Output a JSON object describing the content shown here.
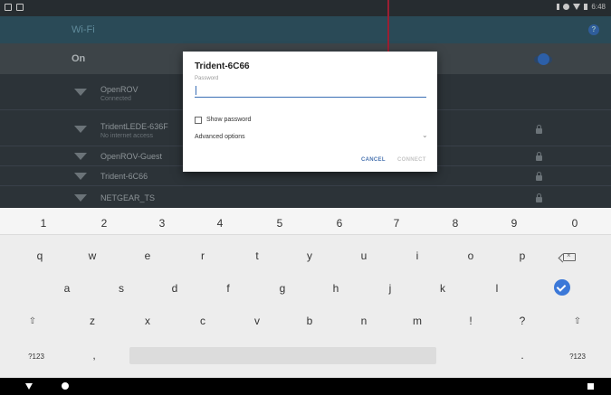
{
  "status_bar": {
    "time": "6:48"
  },
  "settings": {
    "title": "Wi-Fi",
    "toggle_label": "On",
    "toggle_state": "on",
    "networks": [
      {
        "name": "OpenROV",
        "status": "Connected",
        "locked": false
      },
      {
        "name": "TridentLEDE-636F",
        "status": "No internet access",
        "locked": true
      },
      {
        "name": "OpenROV-Guest",
        "status": "",
        "locked": true
      },
      {
        "name": "Trident-6C66",
        "status": "",
        "locked": true
      },
      {
        "name": "NETGEAR_TS",
        "status": "",
        "locked": true
      }
    ]
  },
  "dialog": {
    "title": "Trident-6C66",
    "password_label": "Password",
    "password_value": "",
    "show_password_label": "Show password",
    "show_password_checked": false,
    "advanced_label": "Advanced options",
    "cancel_label": "CANCEL",
    "connect_label": "CONNECT",
    "connect_enabled": false
  },
  "keyboard": {
    "number_row": [
      "1",
      "2",
      "3",
      "4",
      "5",
      "6",
      "7",
      "8",
      "9",
      "0"
    ],
    "row1": [
      "q",
      "w",
      "e",
      "r",
      "t",
      "y",
      "u",
      "i",
      "o",
      "p"
    ],
    "row2": [
      "a",
      "s",
      "d",
      "f",
      "g",
      "h",
      "j",
      "k",
      "l"
    ],
    "row3": [
      "z",
      "x",
      "c",
      "v",
      "b",
      "n",
      "m",
      "!",
      "?"
    ],
    "symbols_label": "?123",
    "comma": ",",
    "period": ".",
    "shift_glyph": "⇧",
    "accent_color": "#3b78d8"
  },
  "colors": {
    "dialog_input_underline": "#3a6fb5",
    "settings_appbar": "#2a4a57"
  }
}
